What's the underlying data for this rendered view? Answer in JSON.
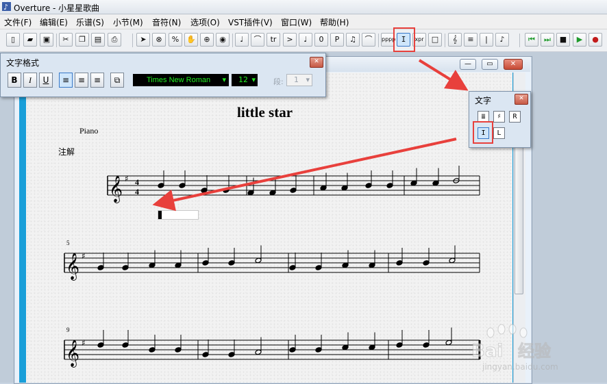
{
  "window": {
    "title": "Overture - 小星星歌曲"
  },
  "menu": [
    "文件(F)",
    "编辑(E)",
    "乐谱(S)",
    "小节(M)",
    "音符(N)",
    "选项(O)",
    "VST插件(V)",
    "窗口(W)",
    "帮助(H)"
  ],
  "toolbar": {
    "file_buttons": [
      "new-file-icon",
      "open-folder-icon",
      "save-icon",
      "cut-icon",
      "copy-icon",
      "paste-icon",
      "print-icon"
    ],
    "edit_tools": [
      "pointer-icon",
      "erase-icon",
      "percent-icon",
      "hand-icon",
      "zoom-icon",
      "speaker-icon"
    ],
    "note_tools": [
      "quarter-note-icon",
      "tie-icon",
      "trill-icon",
      "accent-icon",
      "note-icon",
      "o-icon",
      "p-icon",
      "beam-icon",
      "slur-icon"
    ],
    "mark_tools": [
      "dynamics-icon",
      "text-tool-icon",
      "xpr-icon",
      "box-icon"
    ],
    "clef_tools": [
      "treble-clef-icon",
      "staff-icon",
      "barline-icon",
      "chord-icon"
    ],
    "transport": [
      "rewind-icon",
      "play-from-icon",
      "stop-icon",
      "play-icon",
      "record-icon"
    ],
    "labels": {
      "o": "0",
      "p": "P",
      "xpr": "xpr",
      "dyn": "pppp",
      "tr": "tr"
    }
  },
  "text_format_palette": {
    "title": "文字格式",
    "bold": "B",
    "italic": "I",
    "underline": "U",
    "font": "Times New Roman",
    "size": "12",
    "paragraph_label": "段:",
    "paragraph_value": "1"
  },
  "text_palette": {
    "title": "文字",
    "buttons": [
      "lyrics-icon",
      "chord-symbol-icon",
      "R",
      "text-cursor-icon",
      "L"
    ]
  },
  "score": {
    "title": "little star",
    "instrument": "Piano",
    "note_label": "注解",
    "time_signature": [
      "4",
      "4"
    ],
    "measure_numbers": [
      "5",
      "9"
    ]
  },
  "watermark": {
    "brand": "Bai",
    "cn": "经验",
    "url": "jingyan.baidu.com"
  },
  "colors": {
    "highlight": "#e8403c",
    "arrow": "#e8403c",
    "paper_border": "#1a9fd9",
    "font_display": "#22ee22"
  }
}
